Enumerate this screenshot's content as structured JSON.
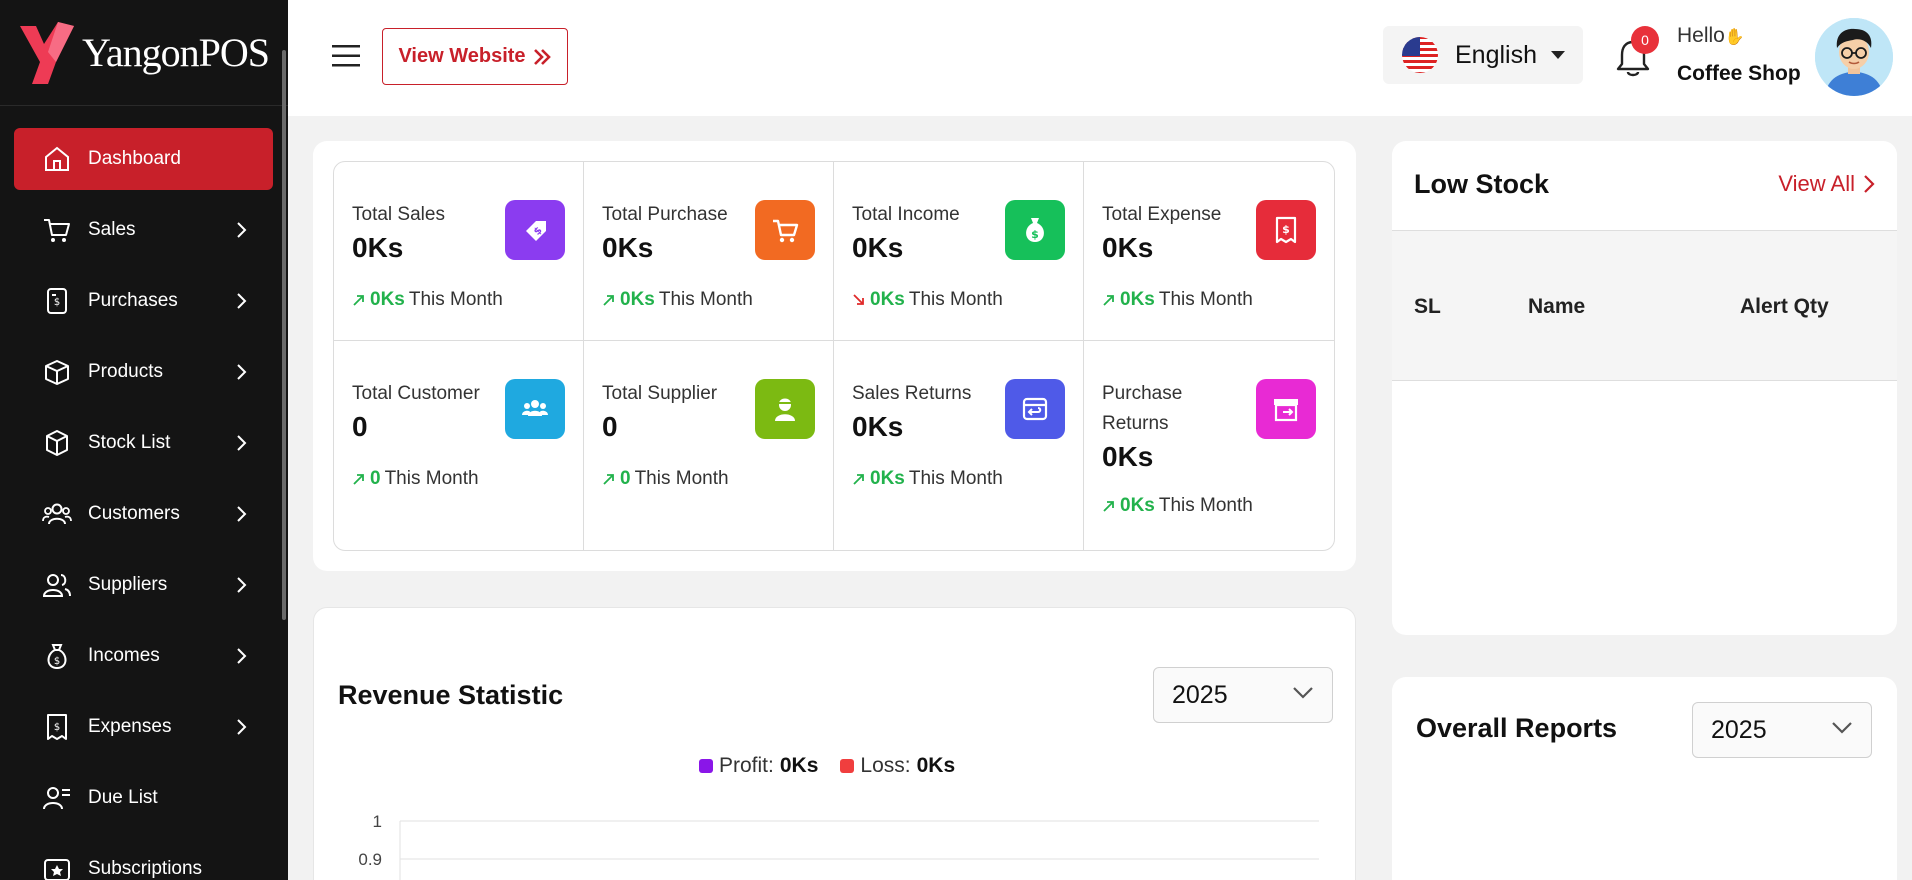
{
  "brand": {
    "name": "YangonPOS",
    "accent": "#c8202a",
    "logo_color": "#ee3b55"
  },
  "sidebar": {
    "items": [
      {
        "label": "Dashboard",
        "icon": "home-icon",
        "active": true,
        "has_children": false
      },
      {
        "label": "Sales",
        "icon": "cart-icon",
        "active": false,
        "has_children": true
      },
      {
        "label": "Purchases",
        "icon": "receipt-icon",
        "active": false,
        "has_children": true
      },
      {
        "label": "Products",
        "icon": "box-icon",
        "active": false,
        "has_children": true
      },
      {
        "label": "Stock List",
        "icon": "cube-icon",
        "active": false,
        "has_children": true
      },
      {
        "label": "Customers",
        "icon": "users-icon",
        "active": false,
        "has_children": true
      },
      {
        "label": "Suppliers",
        "icon": "user-group-icon",
        "active": false,
        "has_children": true
      },
      {
        "label": "Incomes",
        "icon": "money-bag-icon",
        "active": false,
        "has_children": true
      },
      {
        "label": "Expenses",
        "icon": "invoice-icon",
        "active": false,
        "has_children": true
      },
      {
        "label": "Due List",
        "icon": "user-list-icon",
        "active": false,
        "has_children": false
      },
      {
        "label": "Subscriptions",
        "icon": "subscription-icon",
        "active": false,
        "has_children": false
      }
    ]
  },
  "header": {
    "view_website": "View Website",
    "language": "English",
    "notifications": "0",
    "greeting": "Hello",
    "shop_name": "Coffee Shop"
  },
  "stats": [
    {
      "label": "Total Sales",
      "value": "0Ks",
      "month_value": "0Ks",
      "month_label": "This Month",
      "trend": "up",
      "color": "#8b3cf0",
      "icon": "price-tag-icon"
    },
    {
      "label": "Total Purchase",
      "value": "0Ks",
      "month_value": "0Ks",
      "month_label": "This Month",
      "trend": "up",
      "color": "#f26a22",
      "icon": "cart-icon"
    },
    {
      "label": "Total Income",
      "value": "0Ks",
      "month_value": "0Ks",
      "month_label": "This Month",
      "trend": "down",
      "color": "#16c05a",
      "icon": "money-bag-icon"
    },
    {
      "label": "Total Expense",
      "value": "0Ks",
      "month_value": "0Ks",
      "month_label": "This Month",
      "trend": "up",
      "color": "#e62c3a",
      "icon": "bill-icon"
    },
    {
      "label": "Total Customer",
      "value": "0",
      "month_value": "0",
      "month_label": "This Month",
      "trend": "up",
      "color": "#1fa9e0",
      "icon": "customers-icon"
    },
    {
      "label": "Total Supplier",
      "value": "0",
      "month_value": "0",
      "month_label": "This Month",
      "trend": "up",
      "color": "#7cba12",
      "icon": "supplier-icon"
    },
    {
      "label": "Sales Returns",
      "value": "0Ks",
      "month_value": "0Ks",
      "month_label": "This Month",
      "trend": "up",
      "color": "#4f5ae8",
      "icon": "return-box-icon"
    },
    {
      "label": "Purchase Returns",
      "value": "0Ks",
      "month_value": "0Ks",
      "month_label": "This Month",
      "trend": "up",
      "color": "#e82ad4",
      "icon": "archive-return-icon"
    }
  ],
  "revenue": {
    "title": "Revenue Statistic",
    "year": "2025",
    "legend": [
      {
        "name": "Profit:",
        "value": "0Ks",
        "color": "#8a16e8"
      },
      {
        "name": "Loss:",
        "value": "0Ks",
        "color": "#f03e3e"
      }
    ]
  },
  "chart_data": {
    "type": "bar",
    "title": "",
    "categories": [],
    "series": [
      {
        "name": "Profit",
        "values": []
      },
      {
        "name": "Loss",
        "values": []
      }
    ],
    "yticks": [
      "1",
      "0.9"
    ],
    "ylim": [
      0,
      1
    ],
    "grid": true
  },
  "low_stock": {
    "title": "Low Stock",
    "view_all": "View All",
    "columns": [
      "SL",
      "Name",
      "Alert Qty"
    ],
    "rows": []
  },
  "overall": {
    "title": "Overall Reports",
    "year": "2025"
  }
}
